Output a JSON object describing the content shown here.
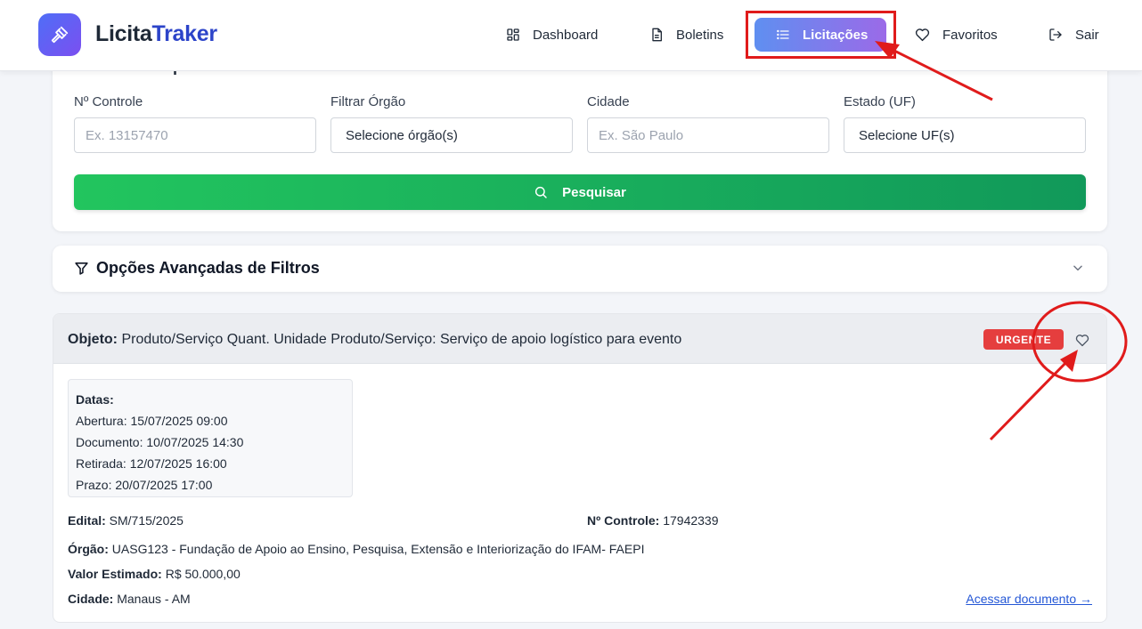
{
  "header": {
    "brand_part1": "Licita",
    "brand_part2": "Traker",
    "nav": [
      {
        "label": "Dashboard",
        "icon": "dashboard-grid-icon"
      },
      {
        "label": "Boletins",
        "icon": "document-icon"
      },
      {
        "label": "Licitações",
        "icon": "list-icon",
        "active": true
      },
      {
        "label": "Favoritos",
        "icon": "heart-icon"
      },
      {
        "label": "Sair",
        "icon": "logout-icon"
      }
    ]
  },
  "filters": {
    "title": "Filtros Principais",
    "controle_label": "Nº Controle",
    "controle_placeholder": "Ex. 13157470",
    "orgao_label": "Filtrar Órgão",
    "orgao_value": "Selecione órgão(s)",
    "cidade_label": "Cidade",
    "cidade_placeholder": "Ex. São Paulo",
    "estado_label": "Estado (UF)",
    "estado_value": "Selecione UF(s)",
    "search_label": "Pesquisar"
  },
  "advanced": {
    "title": "Opções Avançadas de Filtros"
  },
  "result": {
    "objeto_label": "Objeto:",
    "objeto_value": "Produto/Serviço Quant. Unidade Produto/Serviço: Serviço de apoio logístico para evento",
    "badge": "URGENTE",
    "dates_title": "Datas:",
    "dates": [
      {
        "label": "Abertura:",
        "value": "15/07/2025 09:00"
      },
      {
        "label": "Documento:",
        "value": "10/07/2025 14:30"
      },
      {
        "label": "Retirada:",
        "value": "12/07/2025 16:00"
      },
      {
        "label": "Prazo:",
        "value": "20/07/2025 17:00"
      }
    ],
    "edital_label": "Edital:",
    "edital_value": "SM/715/2025",
    "controle_label": "Nº Controle:",
    "controle_value": "17942339",
    "orgao_label": "Órgão:",
    "orgao_value": "UASG123 - Fundação de Apoio ao Ensino, Pesquisa, Extensão e Interiorização do IFAM- FAEPI",
    "valor_label": "Valor Estimado:",
    "valor_value": "R$ 50.000,00",
    "cidade_label": "Cidade:",
    "cidade_value": "Manaus - AM",
    "doc_link": "Acessar documento →"
  },
  "colors": {
    "accent_gradient_start": "#5f8ff0",
    "accent_gradient_end": "#9b6ae8",
    "search_green": "#22c55e",
    "urgent_red": "#e53e3e",
    "annotation_red": "#e01b1b",
    "link_blue": "#2457d6"
  }
}
